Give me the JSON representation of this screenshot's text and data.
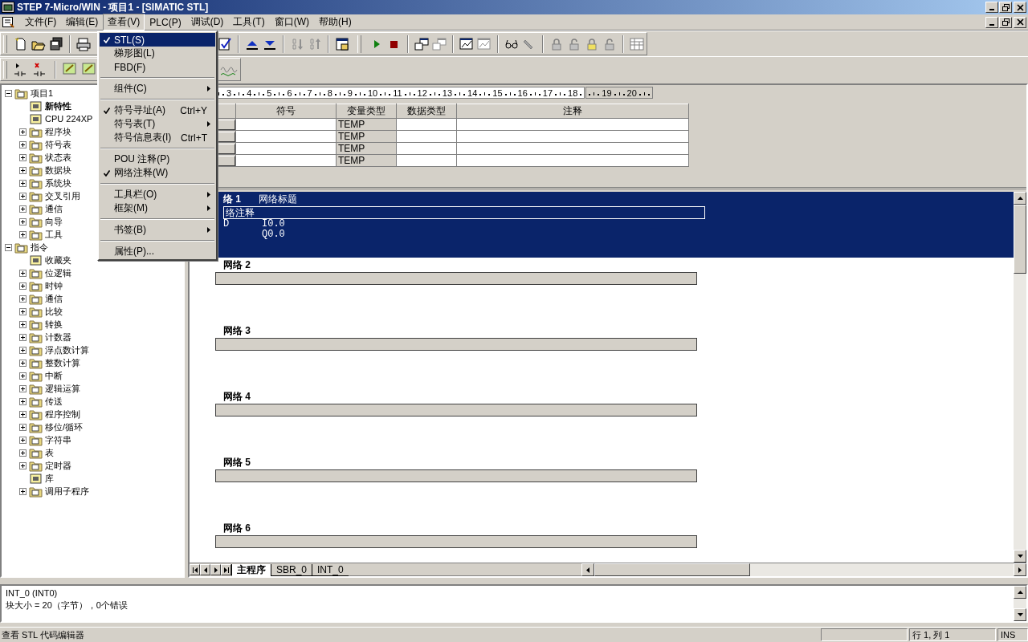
{
  "window": {
    "title": "STEP 7-Micro/WIN - 项目1 - [SIMATIC STL]"
  },
  "menu_bar": [
    {
      "label": "文件(F)",
      "selected": false
    },
    {
      "label": "编辑(E)",
      "selected": false
    },
    {
      "label": "查看(V)",
      "selected": true
    },
    {
      "label": "PLC(P)",
      "selected": false
    },
    {
      "label": "调试(D)",
      "selected": false
    },
    {
      "label": "工具(T)",
      "selected": false
    },
    {
      "label": "窗口(W)",
      "selected": false
    },
    {
      "label": "帮助(H)",
      "selected": false
    }
  ],
  "view_menu": [
    {
      "kind": "item",
      "label": "STL(S)",
      "checked": true,
      "selected": true
    },
    {
      "kind": "item",
      "label": "梯形图(L)",
      "checked": false,
      "selected": false
    },
    {
      "kind": "item",
      "label": "FBD(F)",
      "checked": false,
      "selected": false
    },
    {
      "kind": "separator"
    },
    {
      "kind": "submenu",
      "label": "组件(C)",
      "selected": false
    },
    {
      "kind": "separator"
    },
    {
      "kind": "item",
      "label": "符号寻址(A)",
      "checked": true,
      "selected": false,
      "shortcut": "Ctrl+Y"
    },
    {
      "kind": "submenu",
      "label": "符号表(T)",
      "selected": false
    },
    {
      "kind": "item",
      "label": "符号信息表(I)",
      "checked": false,
      "selected": false,
      "shortcut": "Ctrl+T"
    },
    {
      "kind": "separator"
    },
    {
      "kind": "item",
      "label": "POU 注释(P)",
      "checked": false,
      "selected": false
    },
    {
      "kind": "item",
      "label": "网络注释(W)",
      "checked": true,
      "selected": false
    },
    {
      "kind": "separator"
    },
    {
      "kind": "submenu",
      "label": "工具栏(O)",
      "selected": false
    },
    {
      "kind": "submenu",
      "label": "框架(M)",
      "selected": false
    },
    {
      "kind": "separator"
    },
    {
      "kind": "submenu",
      "label": "书签(B)",
      "selected": false
    },
    {
      "kind": "separator"
    },
    {
      "kind": "item",
      "label": "属性(P)...",
      "checked": false,
      "selected": false
    }
  ],
  "tree": [
    {
      "label": "项目1",
      "expanded": true,
      "children": [
        {
          "label": "新特性",
          "bold": true
        },
        {
          "label": "CPU 224XP"
        },
        {
          "label": "程序块",
          "expanded": false
        },
        {
          "label": "符号表",
          "expanded": false
        },
        {
          "label": "状态表",
          "expanded": false
        },
        {
          "label": "数据块",
          "expanded": false
        },
        {
          "label": "系统块",
          "expanded": false
        },
        {
          "label": "交叉引用",
          "expanded": false
        },
        {
          "label": "通信",
          "expanded": false
        },
        {
          "label": "向导",
          "expanded": false
        },
        {
          "label": "工具",
          "expanded": false
        }
      ]
    },
    {
      "label": "指令",
      "expanded": true,
      "children": [
        {
          "label": "收藏夹"
        },
        {
          "label": "位逻辑",
          "expanded": false
        },
        {
          "label": "时钟",
          "expanded": false
        },
        {
          "label": "通信",
          "expanded": false
        },
        {
          "label": "比较",
          "expanded": false
        },
        {
          "label": "转换",
          "expanded": false
        },
        {
          "label": "计数器",
          "expanded": false
        },
        {
          "label": "浮点数计算",
          "expanded": false
        },
        {
          "label": "整数计算",
          "expanded": false
        },
        {
          "label": "中断",
          "expanded": false
        },
        {
          "label": "逻辑运算",
          "expanded": false
        },
        {
          "label": "传送",
          "expanded": false
        },
        {
          "label": "程序控制",
          "expanded": false
        },
        {
          "label": "移位/循环",
          "expanded": false
        },
        {
          "label": "字符串",
          "expanded": false
        },
        {
          "label": "表",
          "expanded": false
        },
        {
          "label": "定时器",
          "expanded": false
        },
        {
          "label": "库"
        },
        {
          "label": "调用子程序",
          "expanded": false
        }
      ]
    }
  ],
  "ruler": {
    "labels": [
      "3",
      "4",
      "5",
      "6",
      "7",
      "8",
      "9",
      "10",
      "11",
      "12",
      "13",
      "14",
      "15",
      "16",
      "17",
      "18"
    ],
    "overflow_labels": [
      "19",
      "20"
    ]
  },
  "symbol_table": {
    "columns": [
      "符号",
      "变量类型",
      "数据类型",
      "注释"
    ],
    "rows": [
      {
        "var_type": "TEMP"
      },
      {
        "var_type": "TEMP"
      },
      {
        "var_type": "TEMP"
      },
      {
        "var_type": "TEMP"
      }
    ]
  },
  "networks": [
    {
      "title": "络 1",
      "heading": "网络标题",
      "comment": "络注释",
      "selected": true,
      "lines": [
        {
          "op": "D",
          "operand": "I0.0"
        },
        {
          "operand": "Q0.0"
        }
      ]
    },
    {
      "title": "网络 2",
      "selected": false
    },
    {
      "title": "网络 3",
      "selected": false
    },
    {
      "title": "网络 4",
      "selected": false
    },
    {
      "title": "网络 5",
      "selected": false
    },
    {
      "title": "网络 6",
      "selected": false
    }
  ],
  "tabs": [
    {
      "label": "主程序",
      "selected": true
    },
    {
      "label": "SBR_0",
      "selected": false
    },
    {
      "label": "INT_0",
      "selected": false
    }
  ],
  "output": [
    "INT_0 (INT0)",
    "块大小 = 20（字节），0个错误"
  ],
  "status_bar": {
    "message": "查看 STL 代码编辑器",
    "position": "行 1, 列 1",
    "mode": "INS"
  }
}
